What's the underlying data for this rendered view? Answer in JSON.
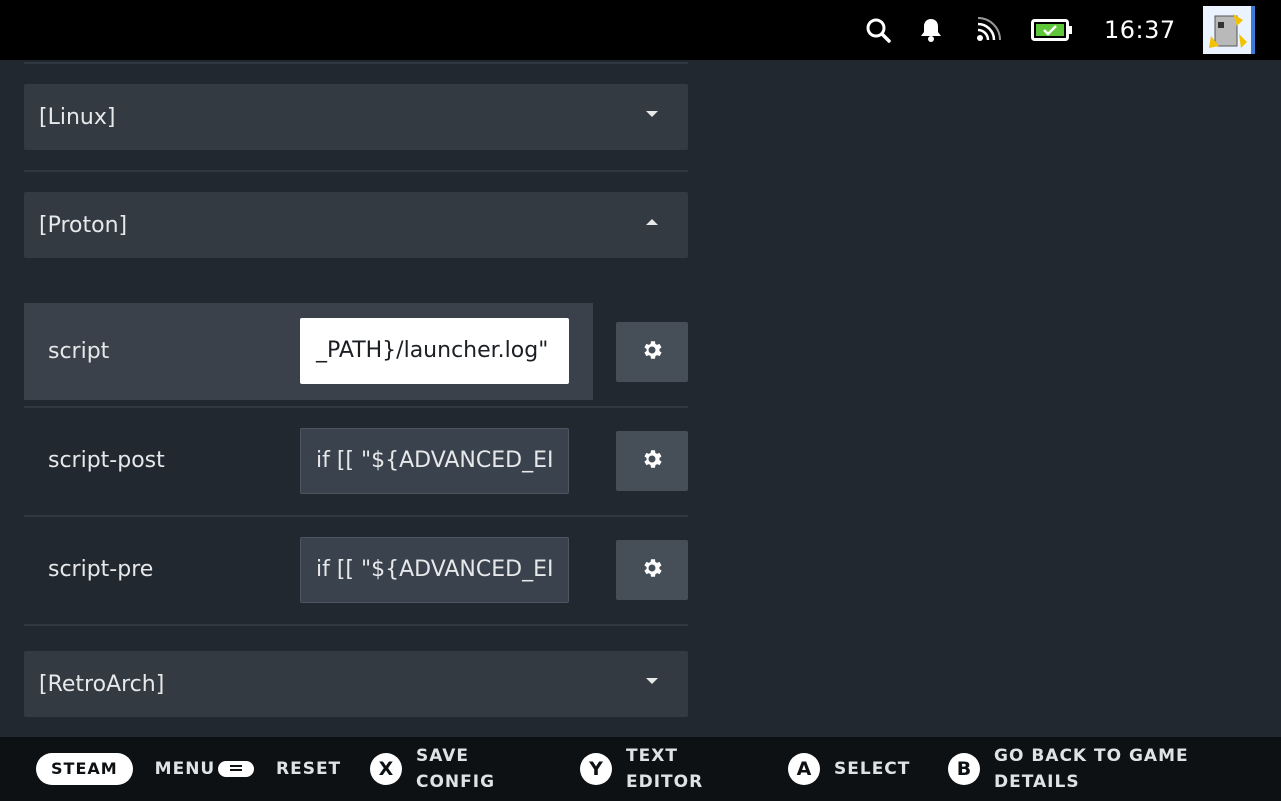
{
  "status_bar": {
    "icons": [
      "search-icon",
      "bell-icon",
      "cast-icon",
      "battery-charging-icon"
    ],
    "time": "16:37",
    "colors": {
      "battery": "#5ec639",
      "background": "#000000"
    }
  },
  "sections": {
    "linux": {
      "label": "[Linux]",
      "state": "collapsed"
    },
    "proton": {
      "label": "[Proton]",
      "state": "expanded"
    },
    "retroarch": {
      "label": "[RetroArch]",
      "state": "collapsed"
    }
  },
  "proton_rows": [
    {
      "label": "script",
      "value": "_PATH}/launcher.log\"",
      "focused": true,
      "action_icon": "gear-icon"
    },
    {
      "label": "script-post",
      "value": "if [[ \"${ADVANCED_EI",
      "focused": false,
      "action_icon": "gear-icon"
    },
    {
      "label": "script-pre",
      "value": "if [[ \"${ADVANCED_EI",
      "focused": false,
      "action_icon": "gear-icon"
    }
  ],
  "footer": {
    "steam": {
      "button": "STEAM",
      "label": "MENU"
    },
    "options": {
      "label": "RESET"
    },
    "x": {
      "button": "X",
      "line1": "SAVE",
      "line2": "CONFIG"
    },
    "y": {
      "button": "Y",
      "line1": "TEXT",
      "line2": "EDITOR"
    },
    "a": {
      "button": "A",
      "label": "SELECT"
    },
    "b": {
      "button": "B",
      "line1": "GO BACK TO GAME",
      "line2": "DETAILS"
    }
  },
  "colors": {
    "panel": "#22282f",
    "row_focus": "#3a414a",
    "field": "#3a424d"
  }
}
